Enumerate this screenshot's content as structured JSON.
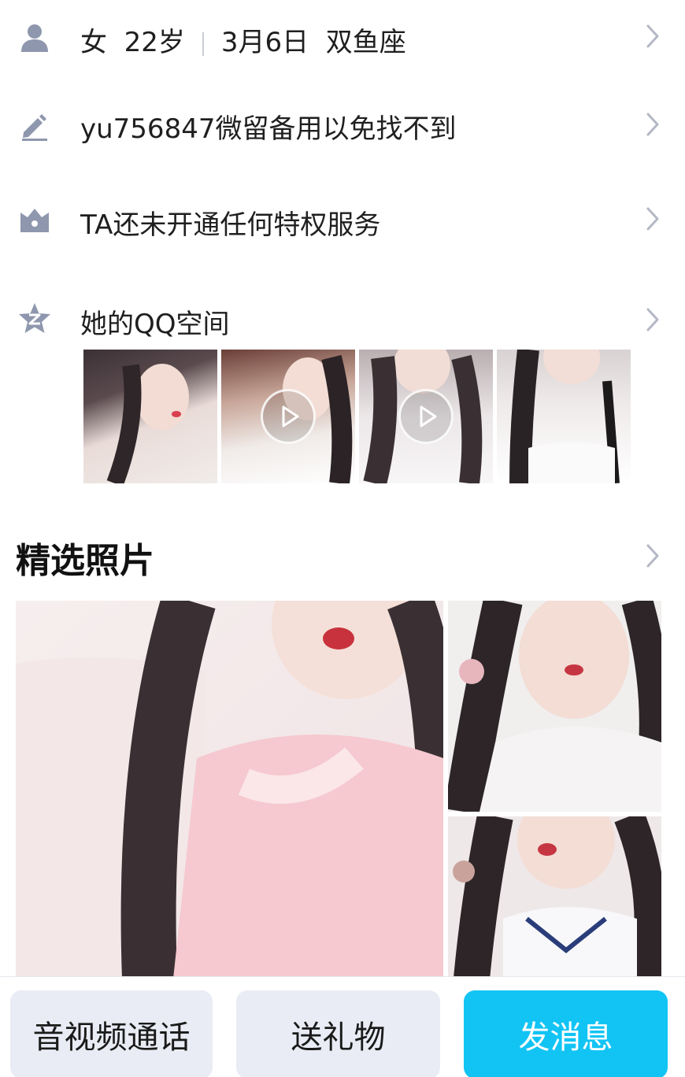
{
  "profile": {
    "gender": "女",
    "age": "22岁",
    "birthday": "3月6日",
    "zodiac": "双鱼座",
    "signature": "yu756847微留备用以免找不到",
    "privilege": "TA还未开通任何特权服务",
    "qzone_label": "她的QQ空间"
  },
  "qzone_thumbs": [
    {
      "type": "photo"
    },
    {
      "type": "video"
    },
    {
      "type": "video"
    },
    {
      "type": "photo"
    }
  ],
  "featured": {
    "title": "精选照片"
  },
  "bottom_bar": {
    "call_label": "音视频通话",
    "gift_label": "送礼物",
    "message_label": "发消息"
  },
  "colors": {
    "icon": "#8e97ad",
    "chevron": "#b3b8c4",
    "primary": "#12c4f4",
    "button_gray": "#e9ecf4"
  }
}
